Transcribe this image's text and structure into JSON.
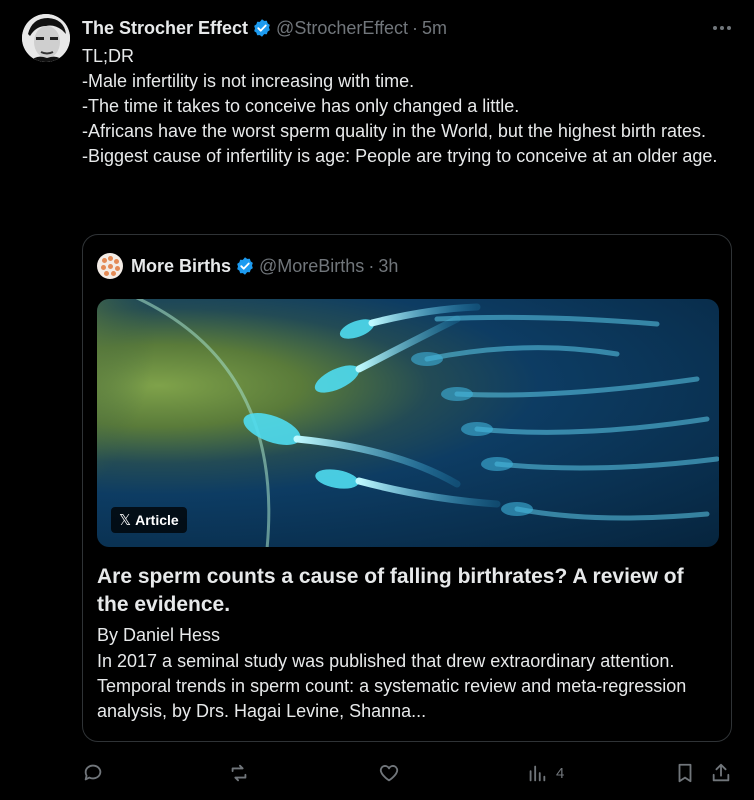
{
  "author": {
    "name": "The Strocher Effect",
    "handle": "@StrocherEffect",
    "separator": "·",
    "time": "5m",
    "verified_color": "#1d9bf0"
  },
  "more_icon": "more-horizontal-icon",
  "tweet_lines": [
    "TL;DR",
    "-Male infertility is not increasing with time.",
    "-The time it takes to conceive has only changed a little.",
    "-Africans have the worst sperm quality in the World, but the highest birth rates.",
    "-Biggest cause of infertility is age: People are trying to conceive at an older age."
  ],
  "quote": {
    "name": "More Births",
    "handle": "@MoreBirths",
    "separator": "·",
    "time": "3h",
    "badge": {
      "x": "𝕏",
      "label": "Article"
    },
    "title": "Are sperm counts a cause of falling birthrates? A review of the evidence.",
    "byline": "By Daniel Hess",
    "summary": "In 2017 a seminal study was published that drew extraordinary attention. Temporal trends in sperm count: a systematic review and meta-regression analysis, by Drs. Hagai Levine, Shanna..."
  },
  "actions": {
    "reply_count": "",
    "repost_count": "",
    "like_count": "",
    "views_count": "4"
  }
}
